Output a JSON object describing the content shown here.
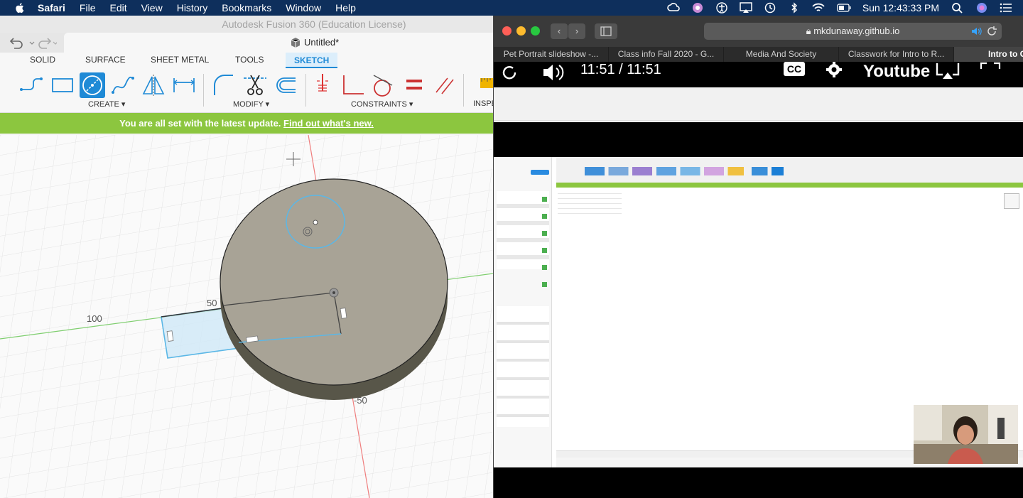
{
  "menubar": {
    "items": [
      "Safari",
      "File",
      "Edit",
      "View",
      "History",
      "Bookmarks",
      "Window",
      "Help"
    ],
    "clock": "Sun 12:43:33 PM",
    "icons": [
      "creative-cloud-icon",
      "siri-color-icon",
      "accessibility-icon",
      "airplay-icon",
      "time-machine-icon",
      "bluetooth-icon",
      "wifi-icon",
      "battery-icon",
      "spotlight-search-icon",
      "siri-icon",
      "notification-list-icon"
    ]
  },
  "fusion": {
    "app_title": "Autodesk Fusion 360 (Education License)",
    "document_title": "Untitled*",
    "ribbon_tabs": [
      "SOLID",
      "SURFACE",
      "SHEET METAL",
      "TOOLS",
      "SKETCH"
    ],
    "active_tab": "SKETCH",
    "groups": {
      "create": "CREATE",
      "modify": "MODIFY",
      "constraints": "CONSTRAINTS",
      "inspect": "INSPE"
    },
    "banner": {
      "text": "You are all set with the latest update.",
      "link": "Find out what's new."
    },
    "canvas": {
      "dim_100": "100",
      "dim_50": "50",
      "dim_neg50": "-50"
    },
    "colors": {
      "accent": "#1f8ad6",
      "banner_green": "#8cc63f",
      "sketch_blue": "#5bb7e6"
    }
  },
  "safari": {
    "url": "mkdunaway.github.io",
    "tabs": [
      "Pet Portrait slideshow -...",
      "Class info Fall 2020 - G...",
      "Media And Society",
      "Classwork for Intro to R...",
      "Intro to C..."
    ],
    "active_tab_index": 4,
    "video": {
      "time": "11:51 / 11:51",
      "brand": "Youtube",
      "cc": "CC"
    }
  }
}
